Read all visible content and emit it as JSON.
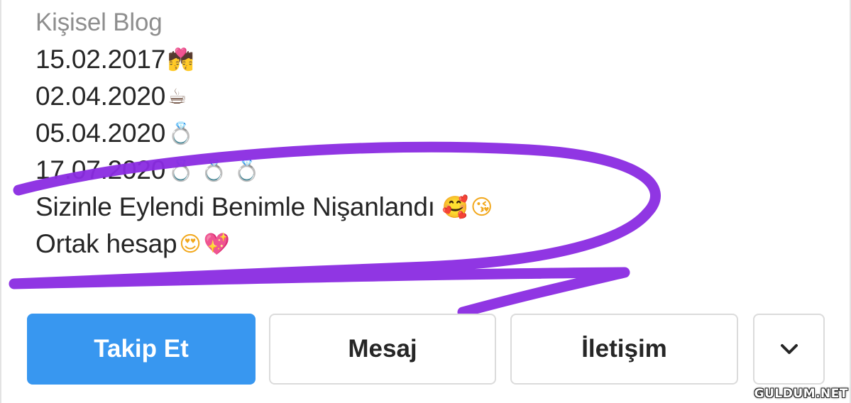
{
  "profile": {
    "category": "Kişisel Blog",
    "bio_lines": [
      {
        "text": "15.02.2017",
        "emoji": "💏"
      },
      {
        "text": "02.04.2020",
        "emoji": "☕"
      },
      {
        "text": "05.04.2020",
        "emoji": "💍"
      },
      {
        "text": "17.07.2020",
        "emoji": "💍 💍 💍"
      },
      {
        "text": "Sizinle Eylendi Benimle Nişanlandı",
        "emoji": "🥰",
        "emoji2": "😘"
      },
      {
        "text": "Ortak hesap",
        "emoji": "😍",
        "emoji2": "💖"
      }
    ]
  },
  "actions": {
    "follow_label": "Takip Et",
    "message_label": "Mesaj",
    "contact_label": "İletişim",
    "more_icon": "chevron-down-icon"
  },
  "annotation": {
    "color": "#8a2be2"
  },
  "watermark": {
    "text": "GULDUM.NET"
  },
  "colors": {
    "follow_button": "#3897f0",
    "category_text": "#8e8e8e",
    "body_text": "#262626",
    "outline_border": "#dbdbdb"
  }
}
